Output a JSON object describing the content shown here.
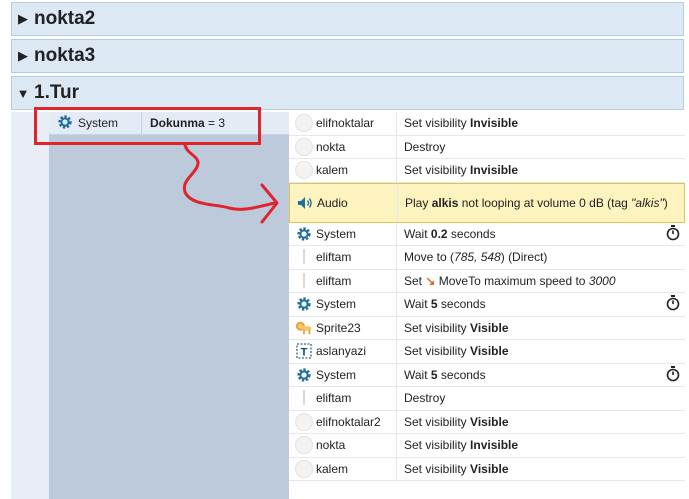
{
  "groups": [
    {
      "title": "nokta2",
      "expanded": false
    },
    {
      "title": "nokta3",
      "expanded": false
    },
    {
      "title": "1.Tur",
      "expanded": true
    }
  ],
  "condition": {
    "object": "System",
    "name": "Dokunma",
    "operator": "= 3"
  },
  "actions": [
    {
      "object": "elifnoktalar",
      "icon": "circle-icon",
      "parts": [
        [
          "Set visibility ",
          ""
        ],
        [
          "Invisible",
          "b"
        ]
      ],
      "wait": false
    },
    {
      "object": "nokta",
      "icon": "circle-icon",
      "parts": [
        [
          "Destroy",
          ""
        ]
      ],
      "wait": false
    },
    {
      "object": "kalem",
      "icon": "circle-icon",
      "parts": [
        [
          "Set visibility ",
          ""
        ],
        [
          "Invisible",
          "b"
        ]
      ],
      "wait": false
    },
    {
      "object": "Audio",
      "icon": "speaker-icon",
      "parts": [
        [
          "Play ",
          ""
        ],
        [
          "alkis",
          "b"
        ],
        [
          " not looping at volume 0 dB (tag ",
          ""
        ],
        [
          "\"alkis\"",
          "i"
        ],
        [
          ")",
          ""
        ]
      ],
      "wait": false,
      "highlight": true
    },
    {
      "object": "System",
      "icon": "gear-icon",
      "parts": [
        [
          "Wait ",
          ""
        ],
        [
          "0.2",
          "b"
        ],
        [
          " seconds",
          ""
        ]
      ],
      "wait": true
    },
    {
      "object": "eliftam",
      "icon": "pencil-icon",
      "parts": [
        [
          "Move to (",
          ""
        ],
        [
          "785, 548",
          "i"
        ],
        [
          ") (Direct)",
          ""
        ]
      ],
      "wait": false
    },
    {
      "object": "eliftam",
      "icon": "pencil-icon",
      "parts": [
        [
          "Set ",
          ""
        ],
        [
          "↘",
          "moveto"
        ],
        [
          " MoveTo maximum speed to ",
          ""
        ],
        [
          "3000",
          "i"
        ]
      ],
      "wait": false
    },
    {
      "object": "System",
      "icon": "gear-icon",
      "parts": [
        [
          "Wait ",
          ""
        ],
        [
          "5",
          "b"
        ],
        [
          " seconds",
          ""
        ]
      ],
      "wait": true
    },
    {
      "object": "Sprite23",
      "icon": "lion-icon",
      "parts": [
        [
          "Set visibility ",
          ""
        ],
        [
          "Visible",
          "b"
        ]
      ],
      "wait": false
    },
    {
      "object": "aslanyazi",
      "icon": "text-object-icon",
      "parts": [
        [
          "Set visibility ",
          ""
        ],
        [
          "Visible",
          "b"
        ]
      ],
      "wait": false
    },
    {
      "object": "System",
      "icon": "gear-icon",
      "parts": [
        [
          "Wait ",
          ""
        ],
        [
          "5",
          "b"
        ],
        [
          " seconds",
          ""
        ]
      ],
      "wait": true
    },
    {
      "object": "eliftam",
      "icon": "pencil-icon",
      "parts": [
        [
          "Destroy",
          ""
        ]
      ],
      "wait": false
    },
    {
      "object": "elifnoktalar2",
      "icon": "circle-icon",
      "parts": [
        [
          "Set visibility ",
          ""
        ],
        [
          "Visible",
          "b"
        ]
      ],
      "wait": false
    },
    {
      "object": "nokta",
      "icon": "circle-icon",
      "parts": [
        [
          "Set visibility ",
          ""
        ],
        [
          "Invisible",
          "b"
        ]
      ],
      "wait": false
    },
    {
      "object": "kalem",
      "icon": "circle-icon",
      "parts": [
        [
          "Set visibility ",
          ""
        ],
        [
          "Visible",
          "b"
        ]
      ],
      "wait": false
    }
  ],
  "colors": {
    "annotation": "#e0242c",
    "gear": "#1f6e9b",
    "audio_highlight": "#fdf3bf"
  }
}
